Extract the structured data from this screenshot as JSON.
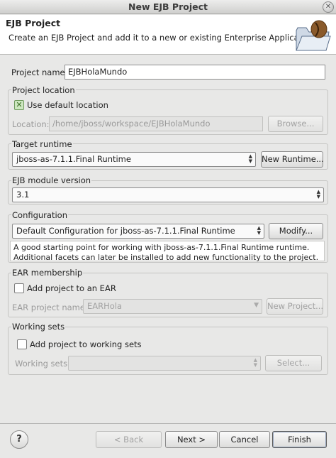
{
  "window": {
    "title": "New EJB Project"
  },
  "banner": {
    "title": "EJB Project",
    "description": "Create an EJB Project and add it to a new or existing Enterprise Application."
  },
  "project_name": {
    "label": "Project name:",
    "value": "EJBHolaMundo"
  },
  "project_location": {
    "group_title": "Project location",
    "use_default_label": "Use default location",
    "use_default_checked": true,
    "location_label": "Location:",
    "location_value": "/home/jboss/workspace/EJBHolaMundo",
    "browse_label": "Browse..."
  },
  "target_runtime": {
    "group_title": "Target runtime",
    "selected": "jboss-as-7.1.1.Final Runtime",
    "new_runtime_label": "New Runtime..."
  },
  "ejb_module_version": {
    "group_title": "EJB module version",
    "selected": "3.1"
  },
  "configuration": {
    "group_title": "Configuration",
    "selected": "Default Configuration for jboss-as-7.1.1.Final Runtime",
    "modify_label": "Modify...",
    "description": "A good starting point for working with jboss-as-7.1.1.Final Runtime runtime. Additional facets can later be installed to add new functionality to the project."
  },
  "ear_membership": {
    "group_title": "EAR membership",
    "add_to_ear_label": "Add project to an EAR",
    "add_to_ear_checked": false,
    "ear_project_label": "EAR project name:",
    "ear_project_value": "EARHola",
    "new_project_label": "New Project..."
  },
  "working_sets": {
    "group_title": "Working sets",
    "add_label": "Add project to working sets",
    "add_checked": false,
    "sets_label": "Working sets:",
    "sets_value": "",
    "select_label": "Select..."
  },
  "footer": {
    "help_label": "?",
    "back_label": "< Back",
    "next_label": "Next >",
    "cancel_label": "Cancel",
    "finish_label": "Finish"
  }
}
